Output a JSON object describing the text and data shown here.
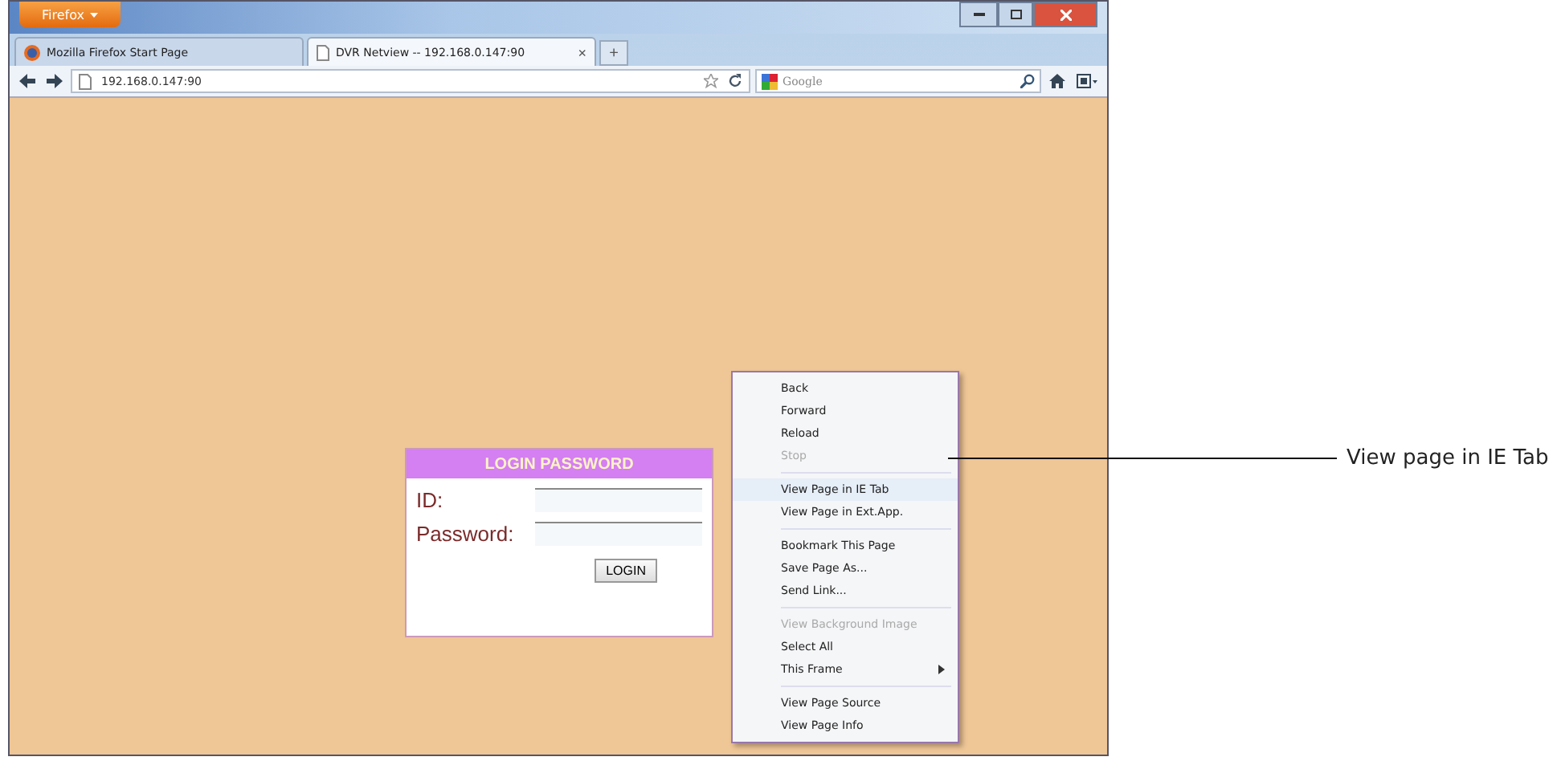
{
  "window": {
    "menu_button": "Firefox",
    "tabs": [
      {
        "title": "Mozilla Firefox Start Page",
        "selected": false,
        "closable": false
      },
      {
        "title": "DVR Netview -- 192.168.0.147:90",
        "selected": true,
        "closable": true
      }
    ],
    "tab_close": "×",
    "new_tab": "+",
    "address": "192.168.0.147:90",
    "search": {
      "placeholder": "Google"
    }
  },
  "login": {
    "title": "LOGIN PASSWORD",
    "fields": [
      {
        "label": "ID:"
      },
      {
        "label": "Password:"
      }
    ],
    "button": "LOGIN"
  },
  "context_menu": {
    "groups": [
      [
        {
          "label": "Back",
          "disabled": false,
          "selected": false,
          "submenu": false
        },
        {
          "label": "Forward",
          "disabled": false,
          "selected": false,
          "submenu": false
        },
        {
          "label": "Reload",
          "disabled": false,
          "selected": false,
          "submenu": false
        },
        {
          "label": "Stop",
          "disabled": true,
          "selected": false,
          "submenu": false
        }
      ],
      [
        {
          "label": "View Page in IE Tab",
          "disabled": false,
          "selected": true,
          "submenu": false
        },
        {
          "label": "View Page in Ext.App.",
          "disabled": false,
          "selected": false,
          "submenu": false
        }
      ],
      [
        {
          "label": "Bookmark This Page",
          "disabled": false,
          "selected": false,
          "submenu": false
        },
        {
          "label": "Save Page As...",
          "disabled": false,
          "selected": false,
          "submenu": false
        },
        {
          "label": "Send Link...",
          "disabled": false,
          "selected": false,
          "submenu": false
        }
      ],
      [
        {
          "label": "View Background Image",
          "disabled": true,
          "selected": false,
          "submenu": false
        },
        {
          "label": "Select All",
          "disabled": false,
          "selected": false,
          "submenu": false
        },
        {
          "label": "This Frame",
          "disabled": false,
          "selected": false,
          "submenu": true
        }
      ],
      [
        {
          "label": "View Page Source",
          "disabled": false,
          "selected": false,
          "submenu": false
        },
        {
          "label": "View Page Info",
          "disabled": false,
          "selected": false,
          "submenu": false
        }
      ]
    ]
  },
  "callout": "View page in IE Tab"
}
